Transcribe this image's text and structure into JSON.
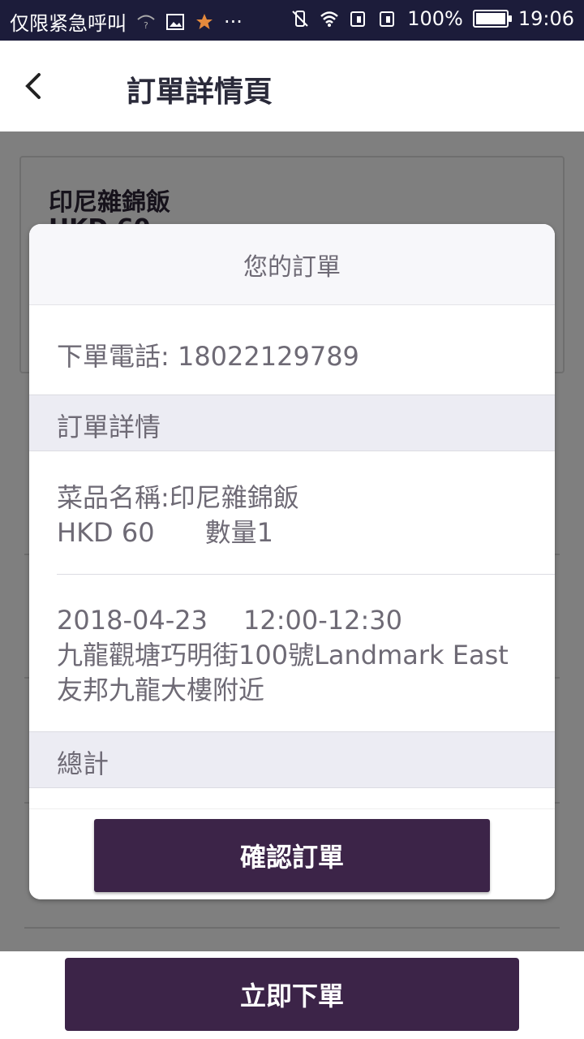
{
  "status_bar": {
    "carrier": "仅限紧急呼叫",
    "battery": "100%",
    "time": "19:06"
  },
  "header": {
    "title": "訂單詳情頁"
  },
  "card": {
    "dish_name": "印尼雜錦飯",
    "price": "HKD 60"
  },
  "dialog": {
    "title": "您的訂單",
    "phone": "下單電話: 18022129789",
    "details_section": "訂單詳情",
    "dish_line": "菜品名稱:印尼雜錦飯",
    "price": "HKD 60",
    "quantity": "數量1",
    "date": "2018-04-23",
    "time_slot": "12:00-12:30",
    "address": "九龍觀塘巧明街100號Landmark East 友邦九龍大樓附近",
    "total_section": "總計",
    "confirm_label": "確認訂單"
  },
  "bottom": {
    "order_now_label": "立即下單"
  },
  "colors": {
    "primary": "#3c2448",
    "status_bar": "#1c1c3a"
  }
}
